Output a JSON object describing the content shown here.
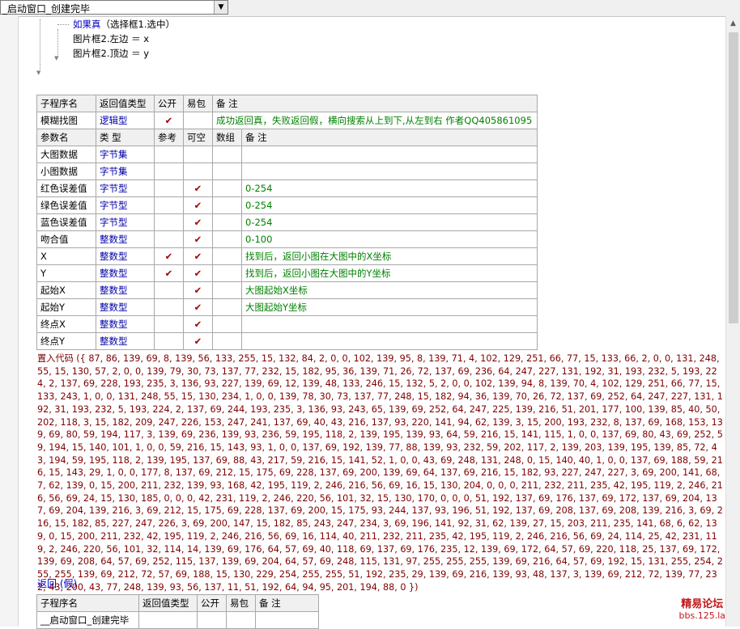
{
  "combo": {
    "text": "_启动窗口_创建完毕"
  },
  "code": {
    "line1_keyword": "如果真",
    "line1_rest": "（选择框1.选中）",
    "line2": "图片框2.左边 ＝ x",
    "line3": "图片框2.顶边 ＝ y"
  },
  "subroutine": {
    "headers": [
      "子程序名",
      "返回值类型",
      "公开",
      "易包",
      "备 注"
    ],
    "name": "模糊找图",
    "return_type": "逻辑型",
    "public_check": "✔",
    "remark": "成功返回真，失败返回假，横向搜索从上到下,从左到右 作者QQ405861095",
    "param_headers": [
      "参数名",
      "类 型",
      "参考",
      "可空",
      "数组",
      "备 注"
    ],
    "params": [
      {
        "name": "大图数据",
        "type": "字节集",
        "ref": "",
        "nullable": "",
        "remark": ""
      },
      {
        "name": "小图数据",
        "type": "字节集",
        "ref": "",
        "nullable": "",
        "remark": ""
      },
      {
        "name": "红色误差值",
        "type": "字节型",
        "ref": "",
        "nullable": "✔",
        "remark": "0-254"
      },
      {
        "name": "绿色误差值",
        "type": "字节型",
        "ref": "",
        "nullable": "✔",
        "remark": "0-254"
      },
      {
        "name": "蓝色误差值",
        "type": "字节型",
        "ref": "",
        "nullable": "✔",
        "remark": "0-254"
      },
      {
        "name": "吻合值",
        "type": "整数型",
        "ref": "",
        "nullable": "✔",
        "remark": "0-100"
      },
      {
        "name": "X",
        "type": "整数型",
        "ref": "✔",
        "nullable": "✔",
        "remark": "找到后，返回小图在大图中的X坐标"
      },
      {
        "name": "Y",
        "type": "整数型",
        "ref": "✔",
        "nullable": "✔",
        "remark": "找到后，返回小图在大图中的Y坐标"
      },
      {
        "name": "起始X",
        "type": "整数型",
        "ref": "",
        "nullable": "✔",
        "remark": "大图起始X坐标"
      },
      {
        "name": "起始Y",
        "type": "整数型",
        "ref": "",
        "nullable": "✔",
        "remark": "大图起始Y坐标"
      },
      {
        "name": "终点X",
        "type": "整数型",
        "ref": "",
        "nullable": "✔",
        "remark": ""
      },
      {
        "name": "终点Y",
        "type": "整数型",
        "ref": "",
        "nullable": "✔",
        "remark": ""
      }
    ]
  },
  "embed_code": "置入代码 ({ 87, 86, 139, 69, 8, 139, 56, 133, 255, 15, 132, 84, 2, 0, 0, 102, 139, 95, 8, 139, 71, 4, 102, 129, 251, 66, 77, 15, 133, 66, 2, 0, 0, 131, 248, 55, 15, 130, 57, 2, 0, 0, 139, 79, 30, 73, 137, 77, 232, 15, 182, 95, 36, 139, 71, 26, 72, 137, 69, 236, 64, 247, 227, 131, 192, 31, 193, 232, 5, 193, 224, 2, 137, 69, 228, 193, 235, 3, 136, 93, 227, 139, 69, 12, 139, 48, 133, 246, 15, 132, 5, 2, 0, 0, 102, 139, 94, 8, 139, 70, 4, 102, 129, 251, 66, 77, 15, 133, 243, 1, 0, 0, 131, 248, 55, 15, 130, 234, 1, 0, 0, 139, 78, 30, 73, 137, 77, 248, 15, 182, 94, 36, 139, 70, 26, 72, 137, 69, 252, 64, 247, 227, 131, 192, 31, 193, 232, 5, 193, 224, 2, 137, 69, 244, 193, 235, 3, 136, 93, 243, 65, 139, 69, 252, 64, 247, 225, 139, 216, 51, 201, 177, 100, 139, 85, 40, 50, 202, 118, 3, 15, 182, 209, 247, 226, 153, 247, 241, 137, 69, 40, 43, 216, 137, 93, 220, 141, 94, 62, 139, 3, 15, 200, 193, 232, 8, 137, 69, 168, 153, 139, 69, 80, 59, 194, 117, 3, 139, 69, 236, 139, 93, 236, 59, 195, 118, 2, 139, 195, 139, 93, 64, 59, 216, 15, 141, 115, 1, 0, 0, 137, 69, 80, 43, 69, 252, 59, 194, 15, 140, 101, 1, 0, 0, 59, 216, 15, 143, 93, 1, 0, 0, 137, 69, 192, 139, 77, 88, 139, 93, 232, 59, 202, 117, 2, 139, 203, 139, 195, 139, 85, 72, 43, 194, 59, 195, 118, 2, 139, 195, 137, 69, 88, 43, 217, 59, 216, 15, 141, 52, 1, 0, 0, 43, 69, 248, 131, 248, 0, 15, 140, 40, 1, 0, 0, 137, 69, 188, 59, 216, 15, 143, 29, 1, 0, 0, 177, 8, 137, 69, 212, 15, 175, 69, 228, 137, 69, 200, 139, 69, 64, 137, 69, 216, 15, 182, 93, 227, 247, 227, 3, 69, 200, 141, 68, 7, 62, 139, 0, 15, 200, 211, 232, 139, 93, 168, 42, 195, 119, 2, 246, 216, 56, 69, 16, 15, 130, 204, 0, 0, 0, 211, 232, 211, 235, 42, 195, 119, 2, 246, 216, 56, 69, 24, 15, 130, 185, 0, 0, 0, 42, 231, 119, 2, 246, 220, 56, 101, 32, 15, 130, 170, 0, 0, 0, 51, 192, 137, 69, 176, 137, 69, 172, 137, 69, 204, 137, 69, 204, 139, 216, 3, 69, 212, 15, 175, 69, 228, 137, 69, 200, 15, 175, 93, 244, 137, 93, 196, 51, 192, 137, 69, 208, 137, 69, 208, 139, 216, 3, 69, 216, 15, 182, 85, 227, 247, 226, 3, 69, 200, 147, 15, 182, 85, 243, 247, 234, 3, 69, 196, 141, 92, 31, 62, 139, 27, 15, 203, 211, 235, 141, 68, 6, 62, 139, 0, 15, 200, 211, 232, 42, 195, 119, 2, 246, 216, 56, 69, 16, 114, 40, 211, 232, 211, 235, 42, 195, 119, 2, 246, 216, 56, 69, 24, 114, 25, 42, 231, 119, 2, 246, 220, 56, 101, 32, 114, 14, 139, 69, 176, 64, 57, 69, 40, 118, 69, 137, 69, 176, 235, 12, 139, 69, 172, 64, 57, 69, 220, 118, 25, 137, 69, 172, 139, 69, 208, 64, 57, 69, 252, 115, 137, 139, 69, 204, 64, 57, 69, 248, 115, 131, 97, 255, 255, 255, 139, 69, 216, 64, 57, 69, 192, 15, 131, 255, 254, 255, 255, 139, 69, 212, 72, 57, 69, 188, 15, 130, 229, 254, 255, 255, 51, 192, 235, 29, 139, 69, 216, 139, 93, 48, 137, 3, 139, 69, 212, 72, 139, 77, 232, 43, 200, 43, 77, 248, 139, 93, 56, 137, 11, 51, 192, 64, 94, 95, 201, 194, 88, 0 })",
  "return_line": "返回 (假)",
  "sub2": {
    "headers": [
      "子程序名",
      "返回值类型",
      "公开",
      "易包",
      "备 注"
    ],
    "name": "__启动窗口_创建完毕"
  },
  "watermark": {
    "line1": "精易论坛",
    "line2": "bbs.125.la"
  }
}
